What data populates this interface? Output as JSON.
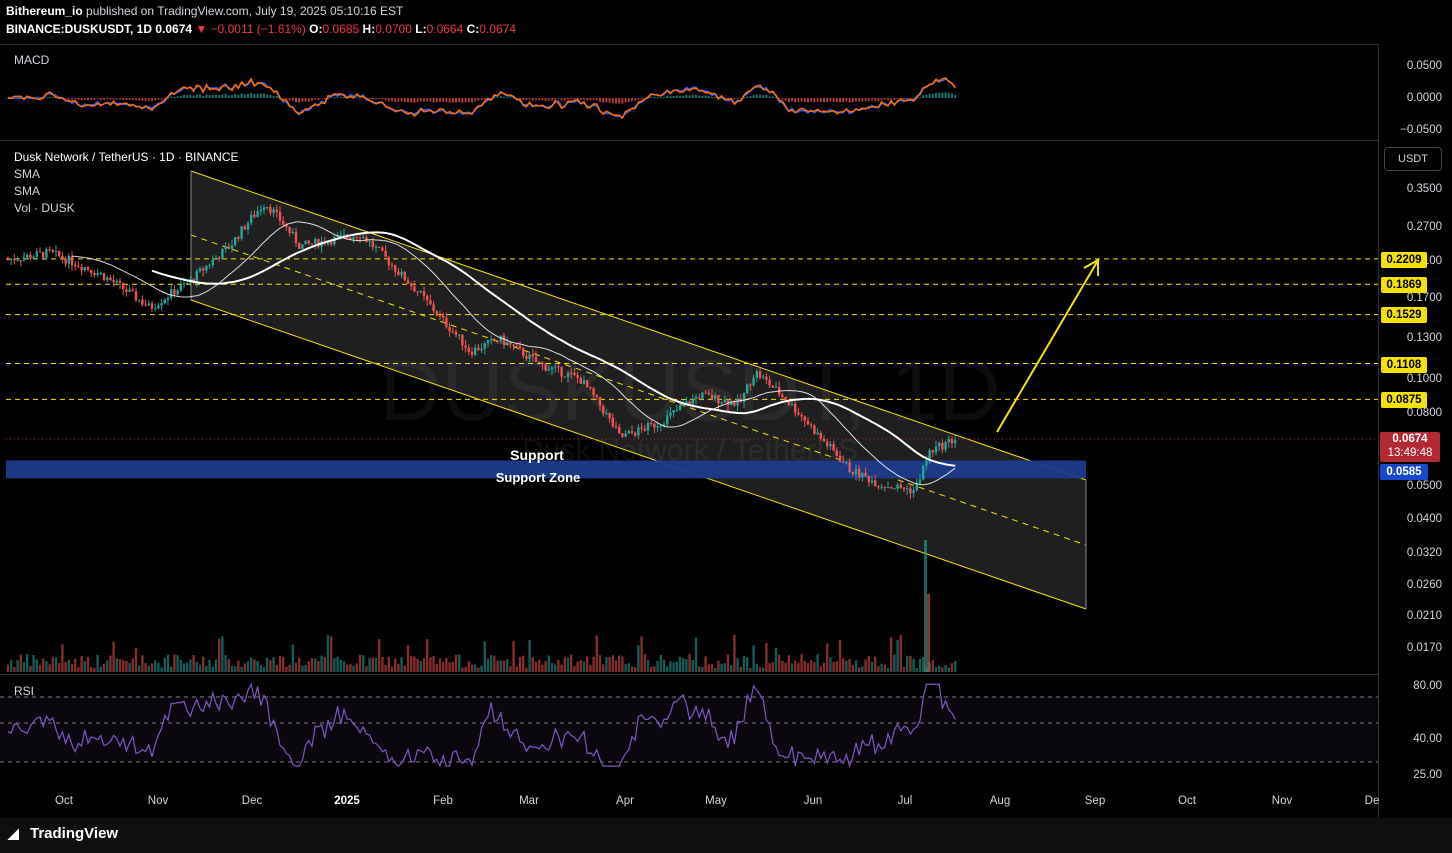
{
  "header": {
    "publisher": "Bithereum_io",
    "published_text": "published on TradingView.com, July 19, 2025 05:10:16 EST",
    "symbol": "BINANCE:DUSKUSDT, 1D",
    "last": "0.0674",
    "change": "▼ −0.0011 (−1.61%)",
    "o_label": "O:",
    "o_value": "0.0685",
    "h_label": "H:",
    "h_value": "0.0700",
    "l_label": "L:",
    "l_value": "0.0664",
    "c_label": "C:",
    "c_value": "0.0674"
  },
  "panes": {
    "macd": {
      "label": "MACD",
      "axis": [
        "0.0500",
        "0.0000",
        "−0.0500"
      ]
    },
    "main": {
      "title": "Dusk Network / TetherUS · 1D · BINANCE",
      "indicators": [
        "SMA",
        "SMA",
        "Vol · DUSK"
      ],
      "currency_button": "USDT",
      "watermark_symbol": "DUSKUSDT, 1D",
      "watermark_name": "Dusk Network / TetherUS",
      "axis": [
        "0.3500",
        "0.2700",
        "0.2100",
        "0.1700",
        "0.1300",
        "0.1000",
        "0.0800",
        "0.0500",
        "0.0400",
        "0.0320",
        "0.0260",
        "0.0210",
        "0.0170"
      ],
      "support_text": "Support",
      "support_zone_text": "Support Zone"
    },
    "rsi": {
      "label": "RSI",
      "axis": [
        "80.00",
        "40.00",
        "25.00"
      ]
    }
  },
  "levels": [
    "0.2209",
    "0.1869",
    "0.1529",
    "0.1108",
    "0.0875"
  ],
  "current_price": {
    "value": "0.0674",
    "countdown": "13:49:48"
  },
  "support_price": "0.0585",
  "x_axis": [
    "Oct",
    "Nov",
    "Dec",
    "2025",
    "Feb",
    "Mar",
    "Apr",
    "May",
    "Jun",
    "Jul",
    "Aug",
    "Sep",
    "Oct",
    "Nov",
    "De"
  ],
  "brand": "TradingView",
  "colors": {
    "up": "#26a69a",
    "down": "#ef5350",
    "channel": "#f5e10a",
    "support_zone": "#1e3a8a",
    "rsi": "#7e57c2",
    "sma_fast": "#ffffff",
    "sma_slow": "#ffffff"
  },
  "chart_data": {
    "type": "candlestick",
    "symbol": "DUSKUSDT",
    "interval": "1D",
    "y_scale": "log",
    "channel": "descending",
    "target_arrow": "up toward 0.2209",
    "horizontal_levels": [
      0.2209,
      0.1869,
      0.1529,
      0.1108,
      0.0875
    ],
    "support_zone": [
      0.052,
      0.0585
    ],
    "last_price": 0.0674
  }
}
